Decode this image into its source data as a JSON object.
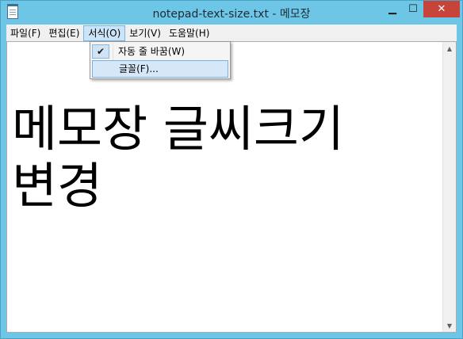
{
  "window": {
    "title": "notepad-text-size.txt - 메모장",
    "controls": {
      "minimize": "▁",
      "maximize": "☐",
      "close": "✕"
    }
  },
  "menu": {
    "items": [
      "파일(F)",
      "편집(E)",
      "서식(O)",
      "보기(V)",
      "도움말(H)"
    ],
    "active_index": 2
  },
  "format_menu": {
    "items": [
      {
        "label": "자동 줄 바꿈(W)",
        "checked": true
      },
      {
        "label": "글꼴(F)...",
        "highlighted": true
      }
    ]
  },
  "editor": {
    "line1": "메모장 글씨크기",
    "line2": "변경"
  },
  "icons": {
    "check": "✔",
    "scroll_up": "▲",
    "scroll_down": "▼"
  }
}
